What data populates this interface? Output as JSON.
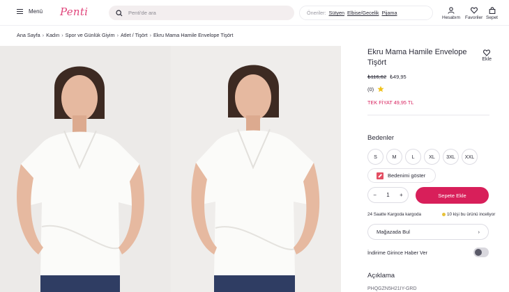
{
  "header": {
    "menu_label": "Menü",
    "logo": "Penti",
    "search_placeholder": "Penti'de ara",
    "suggest_label": "Öneriler:",
    "suggestions": [
      "Sütyen",
      "Elbise/Gecelik",
      "Pijama"
    ],
    "account_label": "Hesabım",
    "favorites_label": "Favoriler",
    "cart_label": "Sepet"
  },
  "breadcrumb": [
    "Ana Sayfa",
    "Kadın",
    "Spor ve Günlük Giyim",
    "Atlet / Tişört",
    "Ekru Mama Hamile Envelope Tişört"
  ],
  "product": {
    "title": "Ekru Mama Hamile Envelope Tişört",
    "fav_label": "Ekle",
    "old_price": "₺116,62",
    "new_price": "₺49,95",
    "rating_count": "(0)",
    "single_price": "TEK FİYAT 49,95 TL",
    "sizes_title": "Bedenler",
    "sizes": [
      "S",
      "M",
      "L",
      "XL",
      "3XL",
      "XXL"
    ],
    "size_chart_label": "Bedenimi göster",
    "quantity": "1",
    "add_to_cart": "Sepete Ekle",
    "cargo_note": "24 Saatte Kargoda kargoda",
    "viewers_note": "10 kişi bu ürünü inceliyor",
    "store_label": "Mağazada Bul",
    "notify_label": "İndirime Girince Haber Ver",
    "description_title": "Açıklama",
    "sku": "PHQGZN5H21IY-GRD"
  },
  "colors": {
    "accent": "#d81f5a",
    "brand": "#e0457b",
    "text": "#2b2b38"
  },
  "icons": [
    "menu-icon",
    "search-icon",
    "user-icon",
    "heart-icon",
    "bag-icon",
    "star-icon",
    "chevron-right-icon"
  ]
}
